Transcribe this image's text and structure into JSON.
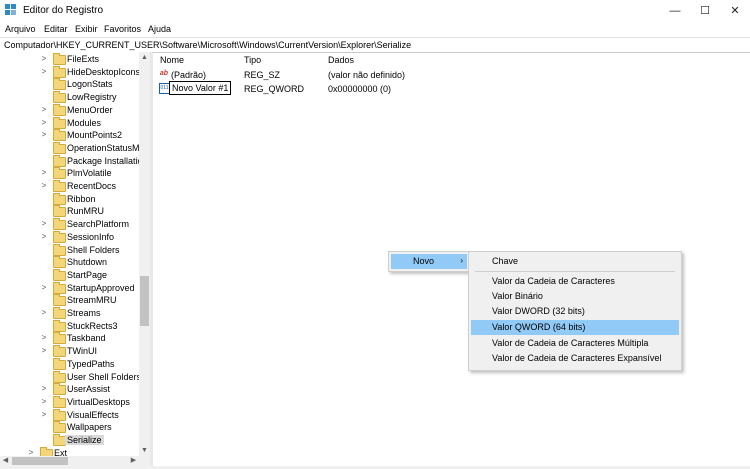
{
  "window": {
    "title": "Editor do Registro"
  },
  "menu": [
    "Arquivo",
    "Editar",
    "Exibir",
    "Favoritos",
    "Ajuda"
  ],
  "address": "Computador\\HKEY_CURRENT_USER\\Software\\Microsoft\\Windows\\CurrentVersion\\Explorer\\Serialize",
  "tree": {
    "items": [
      {
        "label": "FileExts",
        "expandable": true
      },
      {
        "label": "HideDesktopIcons",
        "expandable": true
      },
      {
        "label": "LogonStats",
        "expandable": false
      },
      {
        "label": "LowRegistry",
        "expandable": false
      },
      {
        "label": "MenuOrder",
        "expandable": true
      },
      {
        "label": "Modules",
        "expandable": true
      },
      {
        "label": "MountPoints2",
        "expandable": true
      },
      {
        "label": "OperationStatusMa",
        "expandable": false
      },
      {
        "label": "Package Installatio",
        "expandable": false
      },
      {
        "label": "PlmVolatile",
        "expandable": true
      },
      {
        "label": "RecentDocs",
        "expandable": true
      },
      {
        "label": "Ribbon",
        "expandable": false
      },
      {
        "label": "RunMRU",
        "expandable": false
      },
      {
        "label": "SearchPlatform",
        "expandable": true
      },
      {
        "label": "SessionInfo",
        "expandable": true
      },
      {
        "label": "Shell Folders",
        "expandable": false
      },
      {
        "label": "Shutdown",
        "expandable": false
      },
      {
        "label": "StartPage",
        "expandable": false
      },
      {
        "label": "StartupApproved",
        "expandable": true
      },
      {
        "label": "StreamMRU",
        "expandable": false
      },
      {
        "label": "Streams",
        "expandable": true
      },
      {
        "label": "StuckRects3",
        "expandable": false
      },
      {
        "label": "Taskband",
        "expandable": true
      },
      {
        "label": "TWinUI",
        "expandable": true
      },
      {
        "label": "TypedPaths",
        "expandable": false
      },
      {
        "label": "User Shell Folders",
        "expandable": false
      },
      {
        "label": "UserAssist",
        "expandable": true
      },
      {
        "label": "VirtualDesktops",
        "expandable": true
      },
      {
        "label": "VisualEffects",
        "expandable": true
      },
      {
        "label": "Wallpapers",
        "expandable": false
      },
      {
        "label": "Serialize",
        "expandable": false,
        "selected": true
      }
    ],
    "last_item": {
      "label": "Ext",
      "expandable": true
    }
  },
  "list": {
    "columns": [
      "Nome",
      "Tipo",
      "Dados"
    ],
    "rows": [
      {
        "name": "(Padrão)",
        "type": "REG_SZ",
        "data": "(valor não definido)",
        "icon": "string-value-icon"
      },
      {
        "name": "Novo Valor #1",
        "type": "REG_QWORD",
        "data": "0x00000000 (0)",
        "icon": "binary-value-icon",
        "editing": true
      }
    ]
  },
  "context_menu": {
    "item": "Novo",
    "arrow": "›"
  },
  "submenu": {
    "items": [
      "Chave",
      "Valor da Cadeia de Caracteres",
      "Valor Binário",
      "Valor DWORD (32 bits)",
      "Valor QWORD (64 bits)",
      "Valor de Cadeia de Caracteres Múltipla",
      "Valor de Cadeia de Caracteres Expansível"
    ],
    "highlighted": "Valor QWORD (64 bits)"
  },
  "colors": {
    "highlight": "#91c9f7",
    "folder": "#f3d57a",
    "menu_bg": "#f0f0f0"
  }
}
